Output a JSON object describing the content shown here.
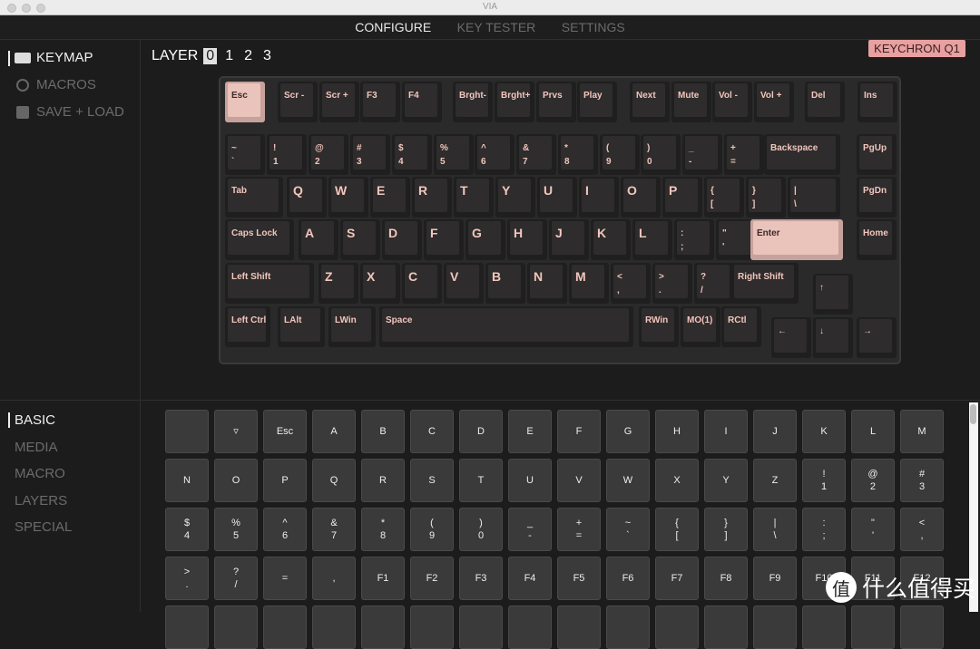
{
  "window": {
    "title": "VIA"
  },
  "nav": {
    "tabs": [
      "CONFIGURE",
      "KEY TESTER",
      "SETTINGS"
    ],
    "active": 0
  },
  "sidebar": {
    "items": [
      "KEYMAP",
      "MACROS",
      "SAVE + LOAD"
    ]
  },
  "layer": {
    "label": "LAYER",
    "options": [
      "0",
      "1",
      "2",
      "3"
    ],
    "selected": 0
  },
  "device": {
    "name": "KEYCHRON Q1"
  },
  "accent": "#eac3bb",
  "keyboard": {
    "keys": [
      "Esc",
      "Scr -",
      "Scr +",
      "F3",
      "F4",
      "Brght-",
      "Brght+",
      "Prvs",
      "Play",
      "Next",
      "Mute",
      "Vol -",
      "Vol +",
      "Del",
      "Ins",
      "~\n`",
      "!\n1",
      "@\n2",
      "#\n3",
      "$\n4",
      "%\n5",
      "^\n6",
      "&\n7",
      "*\n8",
      "(\n9",
      ")\n0",
      "_\n-",
      "+\n=",
      "Backspace",
      "PgUp",
      "Tab",
      "Q",
      "W",
      "E",
      "R",
      "T",
      "Y",
      "U",
      "I",
      "O",
      "P",
      "{\n[",
      "}\n]",
      "|\n\\",
      "PgDn",
      "Caps Lock",
      "A",
      "S",
      "D",
      "F",
      "G",
      "H",
      "J",
      "K",
      "L",
      ":\n;",
      "\"\n'",
      "Enter",
      "Home",
      "Left Shift",
      "Z",
      "X",
      "C",
      "V",
      "B",
      "N",
      "M",
      "<\n,",
      ">\n.",
      "?\n/",
      "Right Shift",
      "↑",
      "Left Ctrl",
      "LAlt",
      "LWin",
      "Space",
      "RWin",
      "MO(1)",
      "RCtl",
      "←",
      "↓",
      "→"
    ],
    "highlighted": [
      "Esc",
      "Enter"
    ]
  },
  "categories": {
    "items": [
      "BASIC",
      "MEDIA",
      "MACRO",
      "LAYERS",
      "SPECIAL"
    ],
    "active": 0
  },
  "keycodes": [
    "",
    "▿",
    "Esc",
    "A",
    "B",
    "C",
    "D",
    "E",
    "F",
    "G",
    "H",
    "I",
    "J",
    "K",
    "L",
    "M",
    "N",
    "O",
    "P",
    "Q",
    "R",
    "S",
    "T",
    "U",
    "V",
    "W",
    "X",
    "Y",
    "Z",
    "!\n1",
    "@\n2",
    "#\n3",
    "$\n4",
    "%\n5",
    "^\n6",
    "&\n7",
    "*\n8",
    "(\n9",
    ")\n0",
    "_\n-",
    "+\n=",
    "~\n`",
    "{\n[",
    "}\n]",
    "|\n\\",
    ":\n;",
    "\"\n'",
    "<\n,",
    ">\n.",
    "?\n/",
    "=",
    ",",
    "F1",
    "F2",
    "F3",
    "F4",
    "F5",
    "F6",
    "F7",
    "F8",
    "F9",
    "F10",
    "F11",
    "F12"
  ],
  "watermark": {
    "text": "什么值得买",
    "badge": "值"
  }
}
